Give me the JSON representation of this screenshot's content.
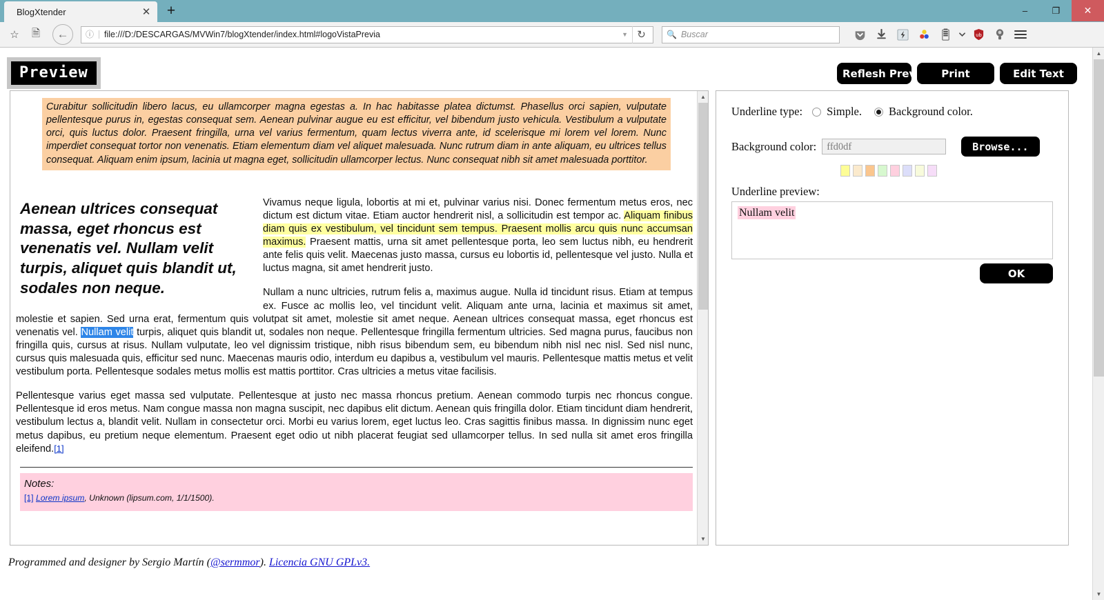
{
  "browser": {
    "tab_title": "BlogXtender",
    "close_tab_icon": "close-icon",
    "new_tab_icon": "plus-icon",
    "window_minimize": "minimize-icon",
    "window_restore": "restore-icon",
    "window_close": "close-icon",
    "url": "file:///D:/DESCARGAS/MVWin7/blogXtender/index.html#logoVistaPrevia",
    "url_info_icon": "info-icon",
    "url_dropdown_icon": "chevron-down-icon",
    "reload_icon": "reload-icon",
    "bookmark_star_icon": "star-icon",
    "library_icon": "library-icon",
    "back_icon": "back-arrow-icon",
    "search_placeholder": "Buscar",
    "search_icon": "search-icon",
    "toolbar_icons": [
      "pocket-icon",
      "downloads-icon",
      "flash-icon",
      "colors-icon",
      "battery-icon",
      "chevron-down-icon",
      "ublock-icon",
      "lightbulb-icon"
    ],
    "menu_icon": "hamburger-menu-icon"
  },
  "app": {
    "logo_text": "Preview",
    "buttons": {
      "refresh": "Reflesh Previe",
      "print": "Print",
      "edit": "Edit Text"
    }
  },
  "document": {
    "intro": "Curabitur sollicitudin libero lacus, eu ullamcorper magna egestas a. In hac habitasse platea dictumst. Phasellus orci sapien, vulputate pellentesque purus in, egestas consequat sem. Aenean pulvinar augue eu est efficitur, vel bibendum justo vehicula. Vestibulum a vulputate orci, quis luctus dolor. Praesent fringilla, urna vel varius fermentum, quam lectus viverra ante, id scelerisque mi lorem vel lorem. Nunc imperdiet consequat tortor non venenatis. Etiam elementum diam vel aliquet malesuada. Nunc rutrum diam in ante aliquam, eu ultrices tellus consequat. Aliquam enim ipsum, lacinia ut magna eget, sollicitudin ullamcorper lectus. Nunc consequat nibh sit amet malesuada porttitor.",
    "pullquote": "Aenean ultrices consequat massa, eget rhoncus est venenatis vel. Nullam velit turpis, aliquet quis blandit ut, sodales non neque.",
    "p1_a": "Vivamus neque ligula, lobortis at mi et, pulvinar varius nisi. Donec fermentum metus eros, nec dictum est dictum vitae. Etiam auctor hendrerit nisl, a sollicitudin est tempor ac. ",
    "p1_highlight": "Aliquam finibus diam quis ex vestibulum, vel tincidunt sem tempus. Praesent mollis arcu quis nunc accumsan maximus.",
    "p1_b": " Praesent mattis, urna sit amet pellentesque porta, leo sem luctus nibh, eu hendrerit ante felis quis velit. Maecenas justo massa, cursus eu lobortis id, pellentesque vel justo. Nulla et luctus magna, sit amet hendrerit justo.",
    "p2_a": "Nullam a nunc ultricies, rutrum felis a, maximus augue. Nulla id tincidunt risus. Etiam at tempus ex. Fusce ac mollis leo, vel tincidunt velit. Aliquam ante urna, lacinia et maximus sit amet, molestie et sapien. Sed urna erat, fermentum quis volutpat sit amet, molestie sit amet neque. Aenean ultrices consequat massa, eget rhoncus est venenatis vel. ",
    "p2_selected": "Nullam velit",
    "p2_b": " turpis, aliquet quis blandit ut, sodales non neque. Pellentesque fringilla fermentum ultricies. Sed magna purus, faucibus non fringilla quis, cursus at risus. Nullam vulputate, leo vel dignissim tristique, nibh risus bibendum sem, eu bibendum nibh nisl nec nisl. Sed nisl nunc, cursus quis malesuada quis, efficitur sed nunc. Maecenas mauris odio, interdum eu dapibus a, vestibulum vel mauris. Pellentesque mattis metus et velit vestibulum porta. Pellentesque sodales metus mollis est mattis porttitor. Cras ultricies a metus vitae facilisis.",
    "p3": "Pellentesque varius eget massa sed vulputate. Pellentesque at justo nec massa rhoncus pretium. Aenean commodo turpis nec rhoncus congue. Pellentesque id eros metus. Nam congue massa non magna suscipit, nec dapibus elit dictum. Aenean quis fringilla dolor. Etiam tincidunt diam hendrerit, vestibulum lectus a, blandit velit. Nullam in consectetur orci. Morbi eu varius lorem, eget luctus leo. Cras sagittis finibus massa. In dignissim nunc eget metus dapibus, eu pretium neque elementum. Praesent eget odio ut nibh placerat feugiat sed ullamcorper tellus. In sed nulla sit amet eros fringilla eleifend.",
    "p3_footnote": "[1]",
    "notes_title": "Notes:",
    "note_num": "[1]",
    "note_source": "Lorem ipsum",
    "note_rest": ", Unknown (lipsum.com, 1/1/1500)."
  },
  "panel": {
    "underline_type_label": "Underline type:",
    "option_simple": "Simple.",
    "option_background": "Background color.",
    "selected_option": "Background color.",
    "background_color_label": "Background color:",
    "background_color_value": "ffd0df",
    "browse_button": "Browse...",
    "preview_label": "Underline preview:",
    "preview_text": "Nullam velit",
    "ok_button": "OK",
    "swatches": [
      "#fdfd96",
      "#fbeacd",
      "#fbc68e",
      "#d7f8cf",
      "#ffd0df",
      "#dcdefa",
      "#f8fbdc",
      "#f6ddf8"
    ]
  },
  "footer": {
    "text_before": "Programmed and designer by Sergio Martín (",
    "handle": "@sermmor",
    "text_mid": "). ",
    "license": "Licencia GNU GPLv3."
  },
  "colors": {
    "intro_background": "#fbcfa2",
    "highlight_yellow": "#ffffa0",
    "selection_blue": "#2f86e8",
    "notes_background": "#ffd0df",
    "titlebar": "#74afbd",
    "close_button": "#cf5a5e"
  }
}
